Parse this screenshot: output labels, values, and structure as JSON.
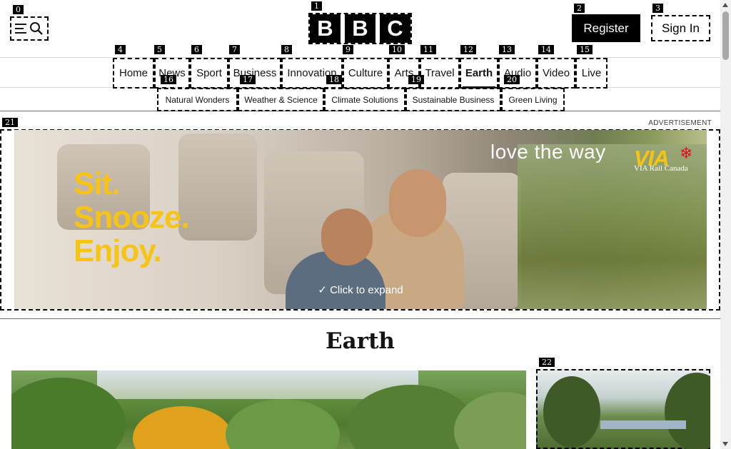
{
  "header": {
    "menu_icon": "hamburger-search-icon",
    "logo_letters": [
      "B",
      "B",
      "C"
    ],
    "register_label": "Register",
    "signin_label": "Sign In"
  },
  "nav": {
    "items": [
      {
        "label": "Home"
      },
      {
        "label": "News"
      },
      {
        "label": "Sport"
      },
      {
        "label": "Business"
      },
      {
        "label": "Innovation"
      },
      {
        "label": "Culture"
      },
      {
        "label": "Arts"
      },
      {
        "label": "Travel"
      },
      {
        "label": "Earth",
        "active": true
      },
      {
        "label": "Audio"
      },
      {
        "label": "Video"
      },
      {
        "label": "Live"
      }
    ]
  },
  "subnav": {
    "items": [
      {
        "label": "Natural Wonders"
      },
      {
        "label": "Weather & Science"
      },
      {
        "label": "Climate Solutions"
      },
      {
        "label": "Sustainable Business"
      },
      {
        "label": "Green Living"
      }
    ]
  },
  "ad": {
    "label": "ADVERTISEMENT",
    "slogan_line1": "Sit.",
    "slogan_line2": "Snooze.",
    "slogan_line3": "Enjoy.",
    "tagline": "love the way",
    "brand": "VIA",
    "brand_sub": "VIA Rail Canada",
    "expand_label": "Click to expand",
    "expand_icon": "chevron-down-icon",
    "slogan_color": "#f7c416"
  },
  "main": {
    "page_title": "Earth"
  },
  "annotations": [
    "0",
    "1",
    "2",
    "3",
    "4",
    "5",
    "6",
    "7",
    "8",
    "9",
    "10",
    "11",
    "12",
    "13",
    "14",
    "15",
    "16",
    "17",
    "18",
    "19",
    "20",
    "21",
    "22"
  ]
}
